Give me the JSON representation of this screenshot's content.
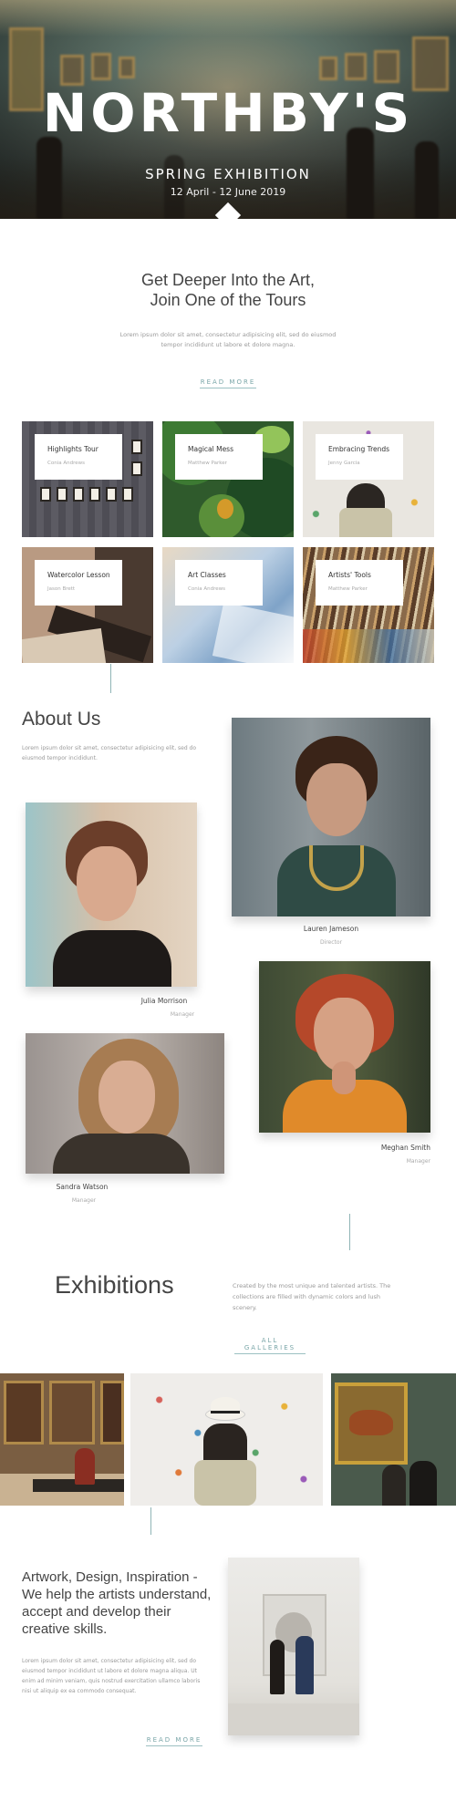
{
  "hero": {
    "title": "NORTHBY'S",
    "subtitle": "SPRING EXHIBITION",
    "dates": "12 April - 12 June 2019"
  },
  "intro": {
    "title_line1": "Get Deeper Into the Art,",
    "title_line2": "Join One of the Tours",
    "text": "Lorem ipsum dolor sit amet, consectetur adipisicing elit, sed do eiusmod tempor incididunt ut labore et dolore magna.",
    "link": "READ MORE"
  },
  "tours": [
    {
      "title": "Highlights Tour",
      "author": "Conia Andrews"
    },
    {
      "title": "Magical Mess",
      "author": "Matthew Parker"
    },
    {
      "title": "Embracing Trends",
      "author": "Jenny Garcia"
    },
    {
      "title": "Watercolor Lesson",
      "author": "Jason Brett"
    },
    {
      "title": "Art Classes",
      "author": "Conia Andrews"
    },
    {
      "title": "Artists' Tools",
      "author": "Matthew Parker"
    }
  ],
  "about": {
    "title": "About Us",
    "text": "Lorem ipsum dolor sit amet, consectetur adipisicing elit, sed do eiusmod tempor incididunt.",
    "people": [
      {
        "name": "Lauren Jameson",
        "role": "Director"
      },
      {
        "name": "Julia Morrison",
        "role": "Manager"
      },
      {
        "name": "Meghan Smith",
        "role": "Manager"
      },
      {
        "name": "Sandra Watson",
        "role": "Manager"
      }
    ]
  },
  "exhibitions": {
    "title": "Exhibitions",
    "text": "Created by the most unique and talented artists. The collections are filled with dynamic colors and lush scenery.",
    "link": "ALL GALLERIES"
  },
  "artwork": {
    "title": "Artwork, Design, Inspiration - We help the artists understand, accept and develop their creative skills.",
    "text": "Lorem ipsum dolor sit amet, consectetur adipisicing elit, sed do eiusmod tempor incididunt ut labore et dolore magna aliqua. Ut enim ad minim veniam, quis nostrud exercitation ullamco laboris nisi ut aliquip ex ea commodo consequat.",
    "link": "READ MORE"
  },
  "colors": {
    "accent": "#7aa6a8",
    "text": "#444444",
    "muted": "#9a9a9a"
  }
}
